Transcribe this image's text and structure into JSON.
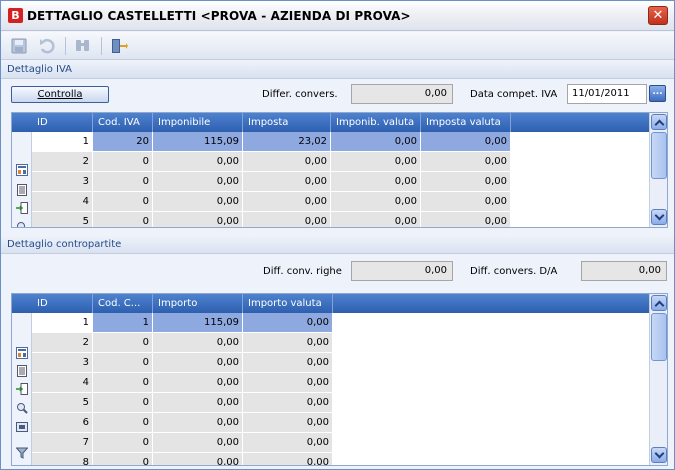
{
  "window": {
    "title": "DETTAGLIO CASTELLETTI <PROVA - AZIENDA DI PROVA>",
    "close_glyph": "✕",
    "app_glyph": "B"
  },
  "toolbar": {
    "buttons": [
      "save-icon",
      "undo-icon",
      "find-icon",
      "exit-icon"
    ]
  },
  "iva_section": {
    "title": "Dettaglio IVA",
    "check_button": "Controlla",
    "differ_label": "Differ. convers.",
    "differ_value": "0,00",
    "data_label": "Data compet. IVA",
    "data_value": "11/01/2011",
    "dots_glyph": "..."
  },
  "iva_grid": {
    "columns": [
      "ID",
      "Cod. IVA",
      "Imponibile",
      "Imposta",
      "Imponib. valuta",
      "Imposta valuta"
    ],
    "rows": [
      [
        "1",
        "20",
        "115,09",
        "23,02",
        "0,00",
        "0,00"
      ],
      [
        "2",
        "0",
        "0,00",
        "0,00",
        "0,00",
        "0,00"
      ],
      [
        "3",
        "0",
        "0,00",
        "0,00",
        "0,00",
        "0,00"
      ],
      [
        "4",
        "0",
        "0,00",
        "0,00",
        "0,00",
        "0,00"
      ],
      [
        "5",
        "0",
        "0,00",
        "0,00",
        "0,00",
        "0,00"
      ]
    ],
    "selected_row": 0,
    "side_icons": [
      "table-icon",
      "list-icon",
      "import-icon",
      "zoom-icon"
    ]
  },
  "contro_section": {
    "title": "Dettaglio contropartite",
    "diff_righe_label": "Diff. conv. righe",
    "diff_righe_value": "0,00",
    "diff_da_label": "Diff. convers. D/A",
    "diff_da_value": "0,00"
  },
  "contro_grid": {
    "columns": [
      "ID",
      "Cod. C...",
      "Importo",
      "Importo valuta"
    ],
    "rows": [
      [
        "1",
        "1",
        "115,09",
        "0,00"
      ],
      [
        "2",
        "0",
        "0,00",
        "0,00"
      ],
      [
        "3",
        "0",
        "0,00",
        "0,00"
      ],
      [
        "4",
        "0",
        "0,00",
        "0,00"
      ],
      [
        "5",
        "0",
        "0,00",
        "0,00"
      ],
      [
        "6",
        "0",
        "0,00",
        "0,00"
      ],
      [
        "7",
        "0",
        "0,00",
        "0,00"
      ],
      [
        "8",
        "0",
        "0,00",
        "0,00"
      ]
    ],
    "selected_row": 0,
    "side_icons": [
      "table-icon",
      "list-icon",
      "import-icon",
      "zoom-icon",
      "frame-icon",
      "filter-icon"
    ]
  },
  "colors": {
    "header_blue": "#2d5fae",
    "selected_row": "#8ea8e0",
    "section_text": "#244a8a"
  }
}
